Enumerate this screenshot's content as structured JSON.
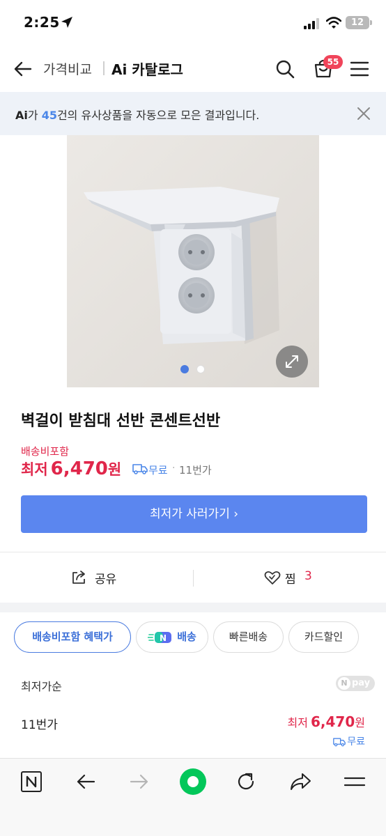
{
  "status_bar": {
    "time": "2:25",
    "battery": "12"
  },
  "header": {
    "back_label": "back",
    "crumb_compare": "가격비교",
    "crumb_catalog": "Ai 카탈로그",
    "cart_badge": "55"
  },
  "ai_banner": {
    "logo": "Ai",
    "prefix": "가 ",
    "count": "45",
    "suffix": "건의 유사상품을 자동으로 모은 결과입니다."
  },
  "gallery": {
    "total": 2,
    "current": 1
  },
  "product": {
    "title": "벽걸이 받침대 선반 콘센트선반",
    "shipping_included": "배송비포함",
    "price_prefix": "최저",
    "price": "6,470",
    "price_unit": "원",
    "shipping": "무료",
    "separator": "·",
    "seller": "11번가",
    "cta": "최저가 사러가기 ›"
  },
  "actions": {
    "share_label": "공유",
    "like_label": "찜",
    "like_count": "3"
  },
  "filters": [
    {
      "label": "배송비포함 혜택가",
      "selected": true
    },
    {
      "label": "배송",
      "badge": "N",
      "selected": false
    },
    {
      "label": "빠른배송",
      "selected": false
    },
    {
      "label": "카드할인",
      "selected": false
    }
  ],
  "sort": {
    "label": "최저가순",
    "npay_n": "N",
    "npay_text": "pay"
  },
  "offers": [
    {
      "seller": "11번가",
      "prefix": "최저",
      "price": "6,470",
      "unit": "원",
      "shipping": "무료"
    }
  ],
  "colors": {
    "accent": "#5b86ef",
    "price_red": "#e0264a",
    "link_blue": "#4a86e8",
    "badge_red": "#f0445a",
    "home_green": "#03c75a"
  },
  "toolbar_icons": [
    "naver-n-icon",
    "back-arrow-icon",
    "forward-arrow-icon",
    "home-icon",
    "reload-icon",
    "share-icon",
    "menu-icon"
  ]
}
